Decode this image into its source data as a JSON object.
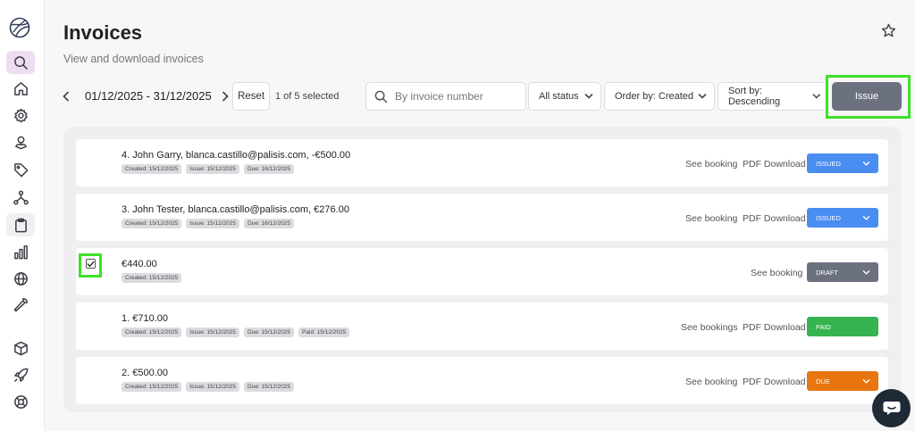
{
  "header": {
    "title": "Invoices",
    "subtitle": "View and download invoices"
  },
  "sidebar": {
    "items": [
      {
        "name": "search-icon"
      },
      {
        "name": "home-icon"
      },
      {
        "name": "gear-icon"
      },
      {
        "name": "user-pin-icon"
      },
      {
        "name": "tag-icon"
      },
      {
        "name": "network-icon"
      },
      {
        "name": "clipboard-icon"
      },
      {
        "name": "bar-chart-icon"
      },
      {
        "name": "globe-icon"
      },
      {
        "name": "wrench-icon"
      },
      {
        "name": "cube-icon"
      },
      {
        "name": "rocket-icon"
      },
      {
        "name": "lifebuoy-icon"
      }
    ]
  },
  "toolbar": {
    "date_range": "01/12/2025 - 31/12/2025",
    "reset_label": "Reset",
    "selected_count": "1 of 5 selected",
    "search_placeholder": "By invoice number",
    "status_filter": "All status",
    "order_by": "Order by: Created",
    "sort_by": "Sort by: Descending",
    "issue_label": "Issue"
  },
  "colors": {
    "issued": "#4a8df0",
    "draft": "#6c7180",
    "paid": "#34b34f",
    "due": "#e8750d",
    "highlight": "#3ee02a"
  },
  "invoices": [
    {
      "title": "4.  John Garry,  blanca.castillo@palisis.com,  -€500.00",
      "tags": [
        "Created: 15/12/2025",
        "Issue: 15/12/2025",
        "Due: 16/12/2025"
      ],
      "see_booking": "See booking",
      "pdf": "PDF Download",
      "status": "ISSUED"
    },
    {
      "title": "3.  John Tester,  blanca.castillo@palisis.com,  €276.00",
      "tags": [
        "Created: 15/12/2025",
        "Issue: 15/12/2025",
        "Due: 16/12/2025"
      ],
      "see_booking": "See booking",
      "pdf": "PDF Download",
      "status": "ISSUED"
    },
    {
      "title": "€440.00",
      "tags": [
        "Created: 15/12/2025"
      ],
      "see_booking": "See booking",
      "status": "DRAFT"
    },
    {
      "title": "1.  €710.00",
      "tags": [
        "Created: 15/12/2025",
        "Issue: 15/12/2025",
        "Due: 15/12/2025",
        "Paid: 15/12/2025"
      ],
      "see_booking": "See bookings",
      "pdf": "PDF Download",
      "status": "PAID"
    },
    {
      "title": "2.  €500.00",
      "tags": [
        "Created: 15/12/2025",
        "Issue: 15/12/2025",
        "Due: 15/12/2025"
      ],
      "see_booking": "See booking",
      "pdf": "PDF Download",
      "status": "DUE"
    }
  ]
}
